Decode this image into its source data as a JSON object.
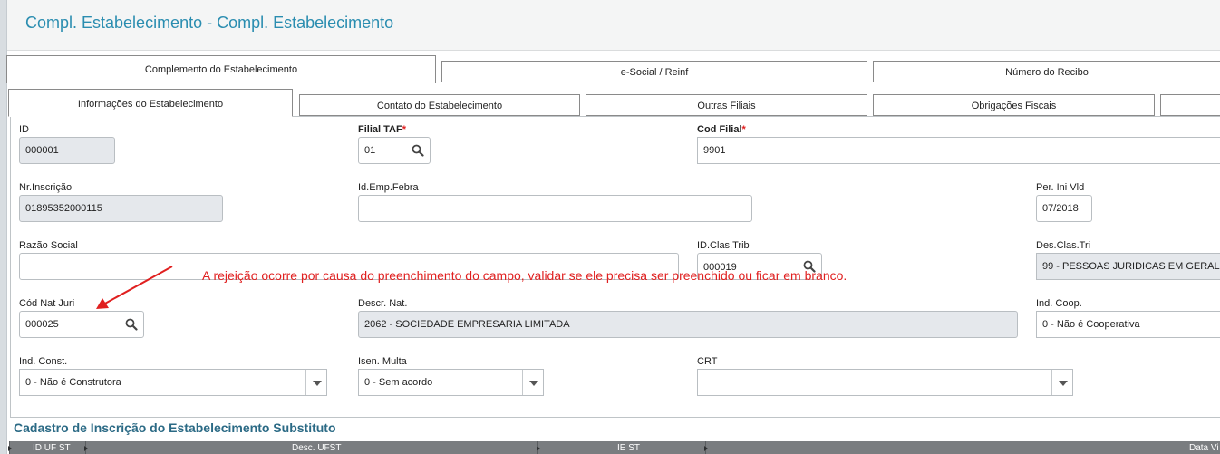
{
  "window": {
    "title": "Compl. Estabelecimento - Compl. Estabelecimento"
  },
  "tabs_level1": [
    {
      "label": "Complemento do Estabelecimento"
    },
    {
      "label": "e-Social / Reinf"
    },
    {
      "label": "Número do Recibo"
    }
  ],
  "tabs_level2": [
    {
      "label": "Informações do Estabelecimento"
    },
    {
      "label": "Contato do Estabelecimento"
    },
    {
      "label": "Outras Filiais"
    },
    {
      "label": "Obrigações Fiscais"
    }
  ],
  "form": {
    "id": {
      "label": "ID",
      "value": "000001"
    },
    "filial_taf": {
      "label": "Filial TAF",
      "required_mark": "*",
      "value": "01"
    },
    "cod_filial": {
      "label": "Cod Filial",
      "required_mark": "*",
      "value": "9901"
    },
    "nr_inscricao": {
      "label": "Nr.Inscrição",
      "value": "01895352000115"
    },
    "id_emp_febra": {
      "label": "Id.Emp.Febra",
      "value": ""
    },
    "per_ini_vld": {
      "label": "Per. Ini Vld",
      "value": "07/2018"
    },
    "razao_social": {
      "label": "Razão Social",
      "value": ""
    },
    "id_clas_trib": {
      "label": "ID.Clas.Trib",
      "value": "000019"
    },
    "des_clas_tri": {
      "label": "Des.Clas.Tri",
      "value": "99 - PESSOAS JURIDICAS EM GERAL"
    },
    "cod_nat_juri": {
      "label": "Cód Nat Juri",
      "value": "000025"
    },
    "descr_nat": {
      "label": "Descr. Nat.",
      "value": "2062 - SOCIEDADE EMPRESARIA LIMITADA"
    },
    "ind_coop": {
      "label": "Ind. Coop.",
      "value": "0 - Não é Cooperativa"
    },
    "ind_const": {
      "label": "Ind. Const.",
      "value": "0 - Não é Construtora"
    },
    "isen_multa": {
      "label": "Isen. Multa",
      "value": "0 - Sem acordo"
    },
    "crt": {
      "label": "CRT",
      "value": ""
    }
  },
  "annotation": {
    "text": "A rejeição ocorre por causa do preenchimento do campo, validar se ele precisa ser preenchido ou ficar em branco.",
    "color": "#e02020"
  },
  "section": {
    "title": "Cadastro de Inscrição do Estabelecimento Substituto"
  },
  "grid": {
    "columns": [
      "ID UF ST",
      "Desc. UFST",
      "IE ST",
      "Data Vi"
    ]
  },
  "colors": {
    "title": "#2a8db0",
    "section_title": "#2b6a85",
    "readonly_bg": "#e5e8ec",
    "required": "#e02020"
  },
  "icons": {
    "lookup": "search-icon",
    "dropdown": "chevron-down-icon"
  }
}
